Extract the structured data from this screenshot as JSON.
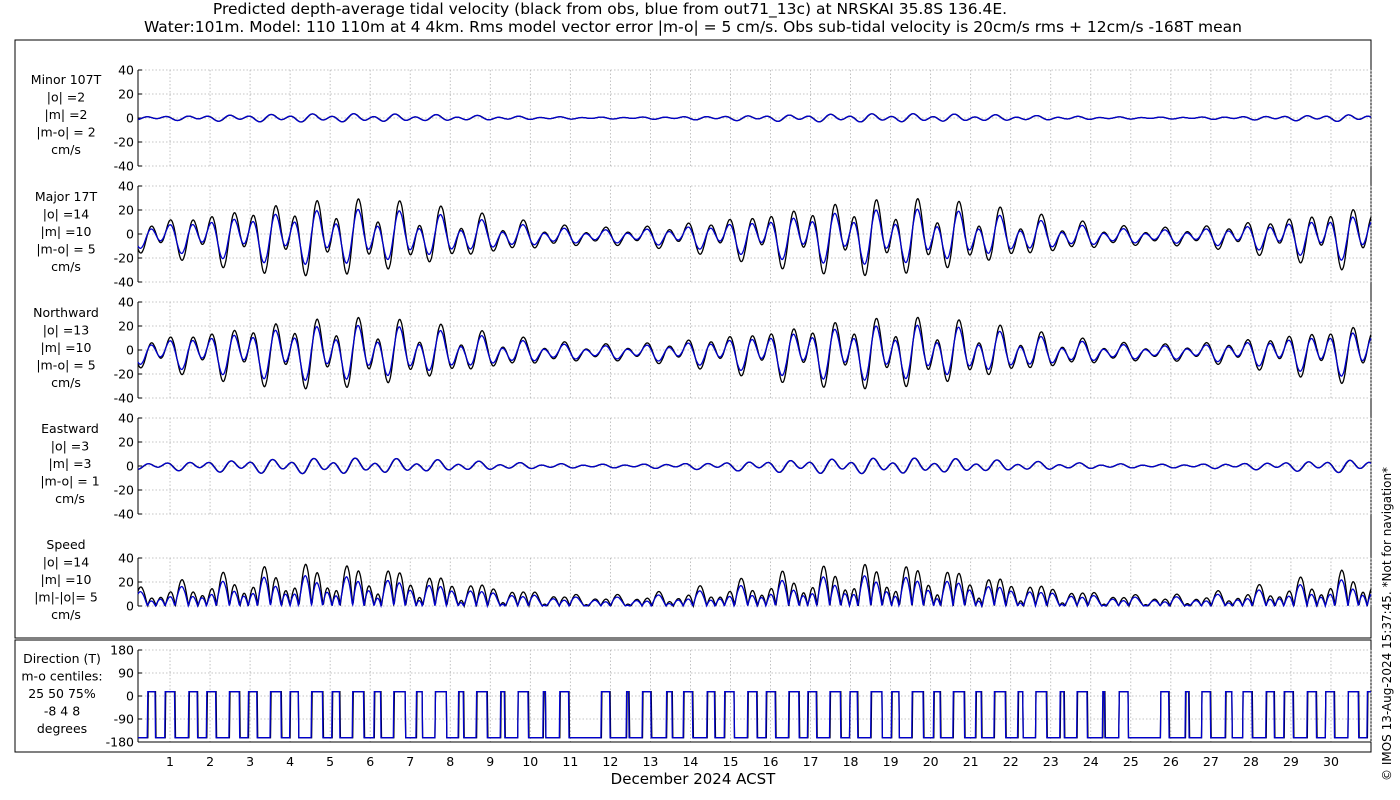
{
  "title_line1": "Predicted depth-average tidal velocity (black from obs, blue from out71_13c) at NRSKAI 35.8S 136.4E.",
  "title_line2": "Water:101m. Model: 110 110m at 4 4km. Rms model vector error |m-o| = 5 cm/s. Obs sub-tidal velocity is 20cm/s rms + 12cm/s -168T mean",
  "copyright": "© IMOS 13-Aug-2024 15:37:45. *Not for navigation*",
  "colors": {
    "obs": "#000000",
    "model": "#0000cc",
    "grid": "#b3b3b3"
  },
  "chart_data": {
    "type": "line",
    "xlabel": "December 2024 ACST",
    "x_ticks": [
      "1",
      "2",
      "3",
      "4",
      "5",
      "6",
      "7",
      "8",
      "9",
      "10",
      "11",
      "12",
      "13",
      "14",
      "15",
      "16",
      "17",
      "18",
      "19",
      "20",
      "21",
      "22",
      "23",
      "24",
      "25",
      "26",
      "27",
      "28",
      "29",
      "30"
    ],
    "x_range_days": [
      0.2,
      31.0
    ],
    "grid": true,
    "series_names": [
      "obs",
      "model"
    ],
    "panels": [
      {
        "id": "minor",
        "label_lines": [
          "Minor 107T",
          "|o| =2",
          "|m| =2",
          "|m-o| = 2",
          "cm/s"
        ],
        "ylim": [
          -40,
          40
        ],
        "yticks": [
          "40",
          "20",
          "0",
          "-20",
          "-40"
        ],
        "yticks_values": [
          40,
          20,
          0,
          -20,
          -40
        ],
        "amplitude_obs": 2,
        "amplitude_model": 2
      },
      {
        "id": "major",
        "label_lines": [
          "Major 17T",
          "|o| =14",
          "|m| =10",
          "|m-o| = 5",
          "cm/s"
        ],
        "ylim": [
          -40,
          40
        ],
        "yticks": [
          "40",
          "20",
          "0",
          "-20",
          "-40"
        ],
        "yticks_values": [
          40,
          20,
          0,
          -20,
          -40
        ],
        "amplitude_obs": 14,
        "amplitude_model": 10
      },
      {
        "id": "northward",
        "label_lines": [
          "Northward",
          "|o| =13",
          "|m| =10",
          "|m-o| = 5",
          "cm/s"
        ],
        "ylim": [
          -40,
          40
        ],
        "yticks": [
          "40",
          "20",
          "0",
          "-20",
          "-40"
        ],
        "yticks_values": [
          40,
          20,
          0,
          -20,
          -40
        ],
        "amplitude_obs": 13,
        "amplitude_model": 10
      },
      {
        "id": "eastward",
        "label_lines": [
          "Eastward",
          "|o| =3",
          "|m| =3",
          "|m-o| = 1",
          "cm/s"
        ],
        "ylim": [
          -40,
          40
        ],
        "yticks": [
          "40",
          "20",
          "0",
          "-20",
          "-40"
        ],
        "yticks_values": [
          40,
          20,
          0,
          -20,
          -40
        ],
        "amplitude_obs": 3,
        "amplitude_model": 3
      },
      {
        "id": "speed",
        "label_lines": [
          "Speed",
          "|o| =14",
          "|m| =10",
          "|m|-|o|= 5",
          "cm/s"
        ],
        "ylim": [
          0,
          40
        ],
        "yticks": [
          "40",
          "20",
          "0"
        ],
        "yticks_values": [
          40,
          20,
          0
        ],
        "amplitude_obs": 14,
        "amplitude_model": 10
      },
      {
        "id": "direction",
        "label_lines": [
          "Direction (T)",
          "m-o centiles:",
          "25  50  75%",
          "-8  4  8",
          "degrees"
        ],
        "ylim": [
          -180,
          180
        ],
        "yticks": [
          "180",
          "90",
          "0",
          "-90",
          "-180"
        ],
        "yticks_values": [
          180,
          90,
          0,
          -90,
          -180
        ]
      }
    ]
  }
}
